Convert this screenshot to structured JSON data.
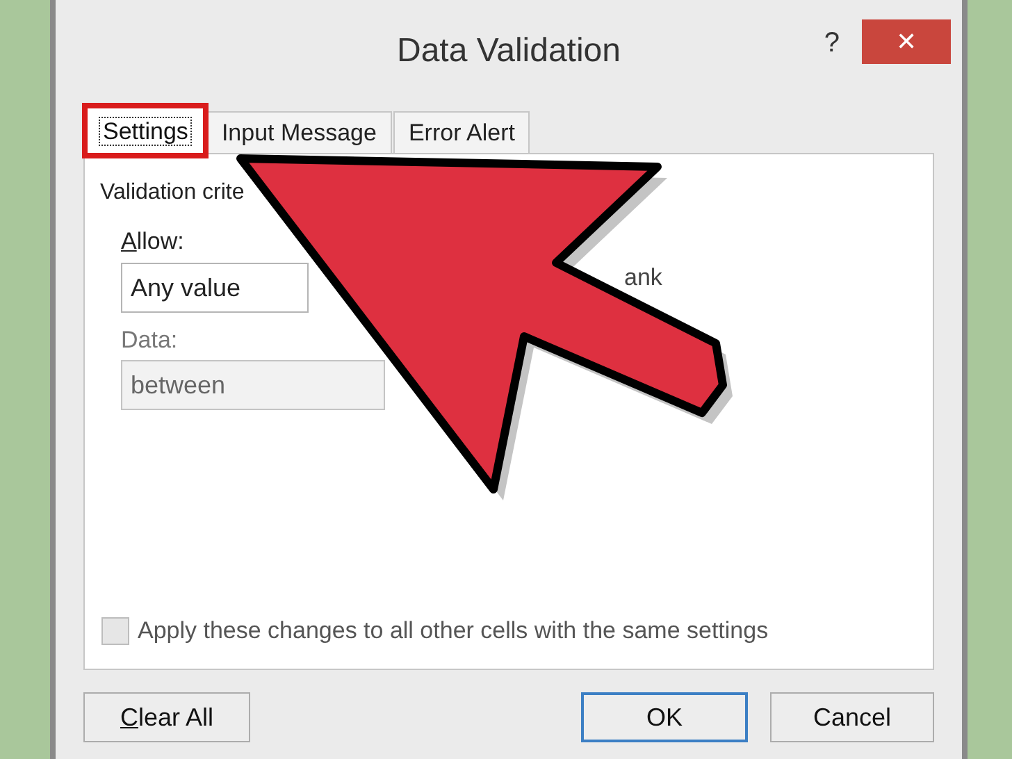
{
  "window": {
    "title": "Data Validation",
    "help": "?",
    "close": "✕"
  },
  "tabs": [
    {
      "label": "Settings",
      "selected": true,
      "highlighted": true
    },
    {
      "label": "Input Message",
      "selected": false,
      "highlighted": false
    },
    {
      "label": "Error Alert",
      "selected": false,
      "highlighted": false
    }
  ],
  "settings": {
    "group_label": "Validation crite",
    "allow": {
      "label": "Allow:",
      "value": "Any value"
    },
    "data": {
      "label": "Data:",
      "value": "between",
      "disabled": true
    },
    "fragment": "ank",
    "apply_all": {
      "label": "Apply these changes to all other cells with the same settings",
      "checked": false,
      "disabled": true
    }
  },
  "buttons": [
    {
      "label": "Clear All",
      "default": false
    },
    {
      "label": "OK",
      "default": true
    },
    {
      "label": "Cancel",
      "default": false
    }
  ]
}
